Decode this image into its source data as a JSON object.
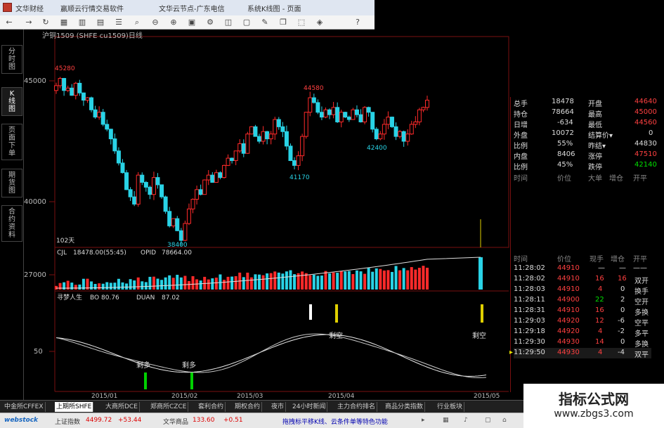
{
  "window": {
    "title_app": "文华财经",
    "title_soft": "赢顺云行情交易软件",
    "title_node": "文华云节点-广东电信",
    "title_view": "系统K线图 - 页面"
  },
  "toolbar": {
    "icons": [
      "back-icon",
      "forward-icon",
      "refresh-icon",
      "grid-icon",
      "chart-icon",
      "chart2-icon",
      "list-icon",
      "zoom-icon",
      "zoom-out-icon",
      "zoom-in-icon",
      "calc-icon",
      "settings-icon",
      "layout-icon",
      "window-icon",
      "note-icon",
      "copy-icon",
      "select-icon",
      "tag-icon",
      "help-icon"
    ]
  },
  "sidebar": {
    "tabs": [
      "分\n时\n图",
      "K\n线\n图",
      "页\n面\n下\n单",
      "期\n货\n图",
      "合\n约\n资\n料"
    ]
  },
  "chart": {
    "symbol_title": "沪铜1509 (SHFE cu1509)日线",
    "price_labels": {
      "p45000": "45000",
      "p40000": "40000",
      "p27000": "27000",
      "p50": "50"
    },
    "days_label": "102天",
    "peak_labels": {
      "high1": "45280",
      "high2": "44580",
      "low1": "38400",
      "low2": "41170",
      "low3": "42400"
    },
    "volume_header": {
      "cjl_label": "CJL",
      "cjl_value": "18478.00(55:45)",
      "opid_label": "OPID",
      "opid_value": "78664.00"
    },
    "indicator_header": {
      "name": "寻梦人生",
      "bo_label": "BO",
      "bo_value": "80.76",
      "duan_label": "DUAN",
      "duan_value": "87.02"
    },
    "signal_labels": {
      "buy1": "剩多",
      "buy2": "剩多",
      "sell1": "剩空",
      "sell2": "剩空"
    },
    "x_dates": [
      "2015/01",
      "2015/02",
      "2015/03",
      "2015/04",
      "2015/05"
    ],
    "colors": {
      "up": "#ff2a2a",
      "down": "#29d3e6",
      "grid": "#7a1010",
      "signal_buy": "#00d000",
      "signal_sell": "#e0d000"
    },
    "chart_data": {
      "type": "candlestick",
      "title": "沪铜1509 (SHFE cu1509)日线",
      "annotated_highs": [
        45280,
        44580
      ],
      "annotated_lows": [
        38400,
        41170,
        42400
      ],
      "y_ticks": [
        45000,
        40000
      ],
      "volume_ticks": [
        27000
      ],
      "indicator_ticks": [
        50
      ],
      "x_ticks": [
        "2015/01",
        "2015/02",
        "2015/03",
        "2015/04",
        "2015/05"
      ],
      "closes": [
        44800,
        45100,
        44600,
        44700,
        44400,
        44900,
        44500,
        44200,
        44300,
        43800,
        43500,
        43700,
        43200,
        43000,
        42600,
        42100,
        41600,
        41200,
        40500,
        40200,
        39900,
        41100,
        40800,
        40600,
        40300,
        41000,
        40700,
        40200,
        39600,
        39000,
        39300,
        38800,
        38400,
        39100,
        39700,
        40100,
        40500,
        40300,
        40900,
        41100,
        40800,
        41200,
        41000,
        41500,
        41800,
        41700,
        42100,
        42400,
        42000,
        42800,
        43100,
        42700,
        42500,
        42900,
        42600,
        42800,
        43400,
        43100,
        42900,
        42300,
        41700,
        41500,
        41900,
        42700,
        43700,
        44300,
        44100,
        43700,
        43500,
        43800,
        43600,
        43900,
        43300,
        43700,
        43500,
        43400,
        43800,
        43600,
        43300,
        43900,
        43700,
        43000,
        42600,
        42800,
        43200,
        43500,
        43100,
        42700,
        42900,
        42500,
        42800,
        43200,
        43300,
        43800,
        43900,
        44200
      ]
    }
  },
  "info": {
    "rows": [
      [
        "总手",
        "18478",
        "开盘",
        "44640"
      ],
      [
        "持仓",
        "78664",
        "最高",
        "45000"
      ],
      [
        "日增",
        "-634",
        "最低",
        "44560"
      ],
      [
        "外盘",
        "10072",
        "结算价▾",
        "0"
      ],
      [
        "比例",
        "55%",
        "昨结▾",
        "44830"
      ],
      [
        "内盘",
        "8406",
        "涨停",
        "47510"
      ],
      [
        "比例",
        "45%",
        "跌停",
        "42140"
      ]
    ],
    "top_header": [
      "时间",
      "价位",
      "大单",
      "增仓",
      "开平"
    ],
    "trades_header": [
      "时间",
      "价位",
      "现手",
      "增仓",
      "开平"
    ],
    "trades": [
      [
        "11:28:02",
        "44910",
        "—",
        "—",
        "——"
      ],
      [
        "11:28:02",
        "44910",
        "16",
        "16",
        "双开"
      ],
      [
        "11:28:03",
        "44910",
        "4",
        "0",
        "换手"
      ],
      [
        "11:28:11",
        "44900",
        "22",
        "2",
        "空开"
      ],
      [
        "11:28:31",
        "44910",
        "16",
        "0",
        "多换"
      ],
      [
        "11:29:03",
        "44920",
        "12",
        "-6",
        "空平"
      ],
      [
        "11:29:18",
        "44920",
        "4",
        "-2",
        "多平"
      ],
      [
        "11:29:30",
        "44930",
        "14",
        "0",
        "多换"
      ],
      [
        "11:29:50",
        "44930",
        "4",
        "-4",
        "双平"
      ]
    ]
  },
  "bottom_tabs": [
    "中金所CFFEX",
    "上期所SHFE",
    "大商所DCE",
    "郑商所CZCE",
    "套利合约",
    "期权合约",
    "夜市",
    "24小时新闻",
    "主力合约排名",
    "商品分类指数",
    "行业板块"
  ],
  "statusbar": {
    "logo": "webstock",
    "index1_label": "上证指数",
    "index1_value": "4499.72",
    "index1_change": "+53.44",
    "index2_label": "文华商品",
    "index2_value": "133.60",
    "index2_change": "+0.51",
    "promo": "拖拽标平移K线、云条件单等特色功能"
  },
  "watermark": {
    "line1": "指标公式网",
    "line2": "www.zbgs3.com"
  }
}
